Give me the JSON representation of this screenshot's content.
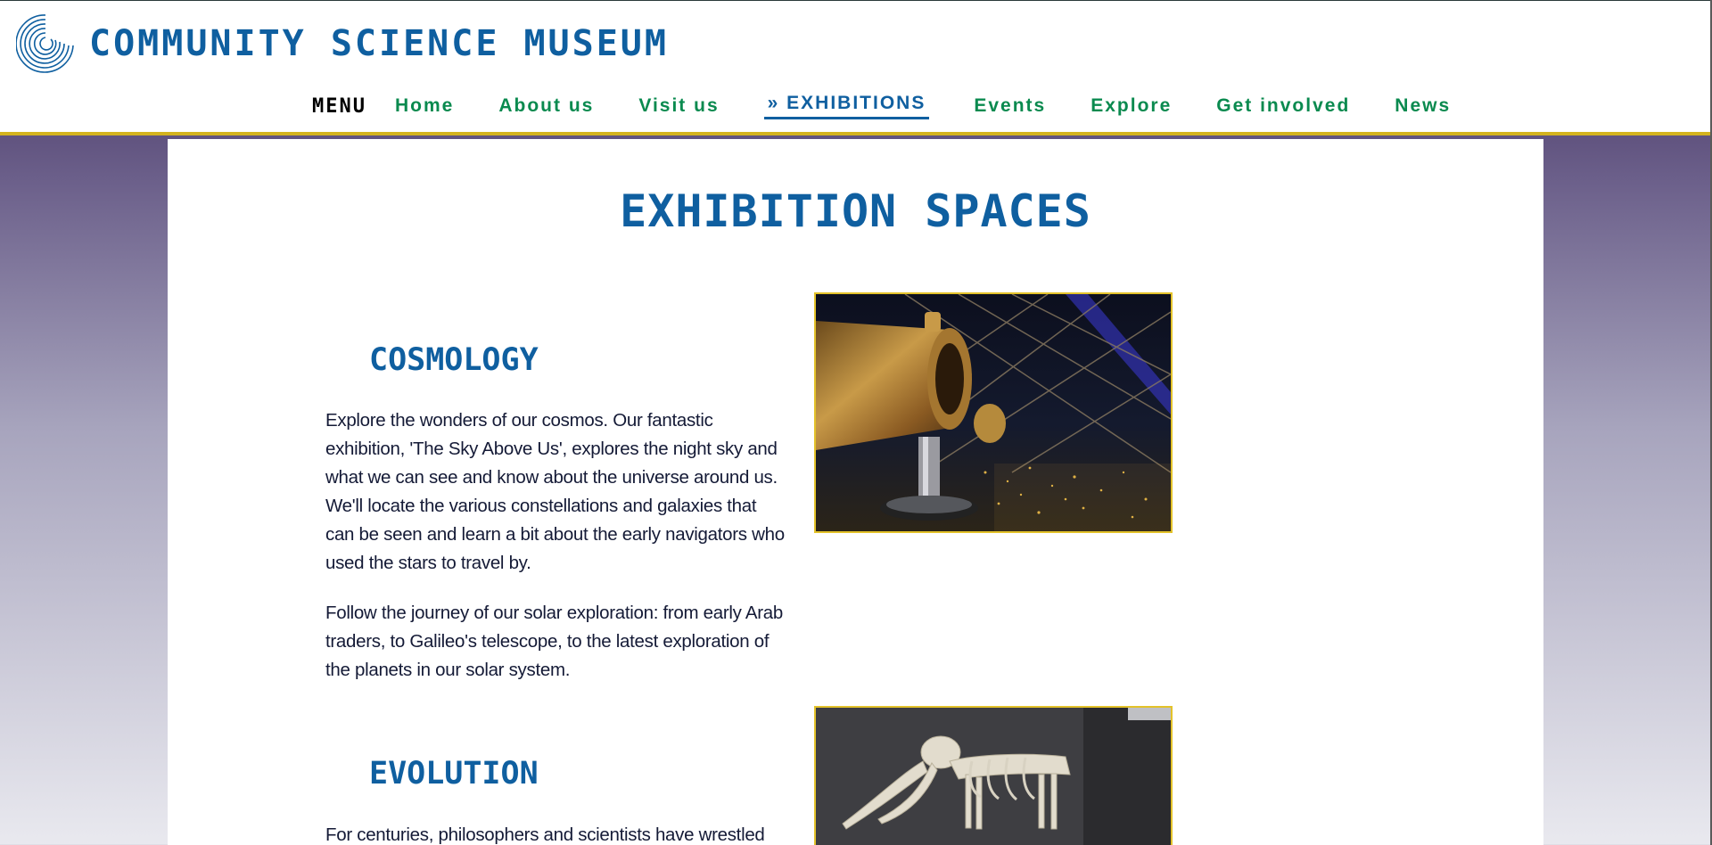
{
  "site": {
    "title": "COMMUNITY SCIENCE MUSEUM"
  },
  "nav": {
    "menu_label": "MENU",
    "items": [
      {
        "label": "Home"
      },
      {
        "label": "About us"
      },
      {
        "label": "Visit us"
      },
      {
        "label": "» EXHIBITIONS",
        "active": true
      },
      {
        "label": "Events"
      },
      {
        "label": "Explore"
      },
      {
        "label": "Get involved"
      },
      {
        "label": "News"
      }
    ]
  },
  "main": {
    "page_title": "EXHIBITION SPACES",
    "sections": [
      {
        "heading": "COSMOLOGY",
        "paragraphs": [
          "Explore the wonders of our cosmos. Our fantastic exhibition, 'The Sky Above Us', explores the night sky and what we can see and know about the universe around us. We'll locate the various constellations and galaxies that can be seen and learn a bit about the early navigators who used the stars to travel by.",
          "Follow the journey of our solar exploration: from early Arab traders, to Galileo's telescope, to the latest exploration of the planets in our solar system."
        ],
        "image": "telescope-photo"
      },
      {
        "heading": "EVOLUTION",
        "paragraphs": [
          "For centuries, philosophers and scientists have wrestled with"
        ],
        "image": "mammoth-skeleton-photo"
      }
    ]
  },
  "colors": {
    "brand_blue": "#0f5fa0",
    "nav_green": "#0a8a4f",
    "accent_gold": "#d4b31e",
    "body_text": "#141a36"
  },
  "icons": {
    "logo": "spiral-logo-icon"
  }
}
